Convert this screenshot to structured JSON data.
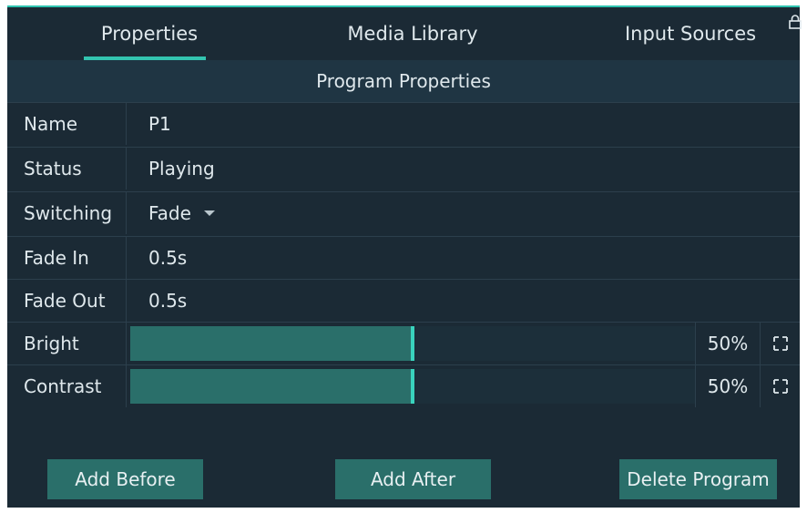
{
  "tabs": [
    {
      "label": "Properties",
      "active": true
    },
    {
      "label": "Media Library",
      "active": false
    },
    {
      "label": "Input Sources",
      "active": false
    }
  ],
  "section_title": "Program Properties",
  "rows": {
    "name": {
      "label": "Name",
      "value": "P1"
    },
    "status": {
      "label": "Status",
      "value": "Playing"
    },
    "switching": {
      "label": "Switching",
      "value": "Fade"
    },
    "fade_in": {
      "label": "Fade In",
      "value": "0.5s"
    },
    "fade_out": {
      "label": "Fade Out",
      "value": "0.5s"
    }
  },
  "sliders": {
    "bright": {
      "label": "Bright",
      "percent_text": "50%",
      "level": 0.5
    },
    "contrast": {
      "label": "Contrast",
      "percent_text": "50%",
      "level": 0.5
    }
  },
  "buttons": {
    "add_before": "Add Before",
    "add_after": "Add After",
    "delete_program": "Delete Program"
  },
  "icons": {
    "lock": "lock-icon",
    "reset": "reset-icon",
    "dropdown": "chevron-down-icon"
  },
  "colors": {
    "accent": "#33c4b0",
    "panel_bg": "#1b2a35",
    "slider_fill": "#2a6f6a"
  }
}
